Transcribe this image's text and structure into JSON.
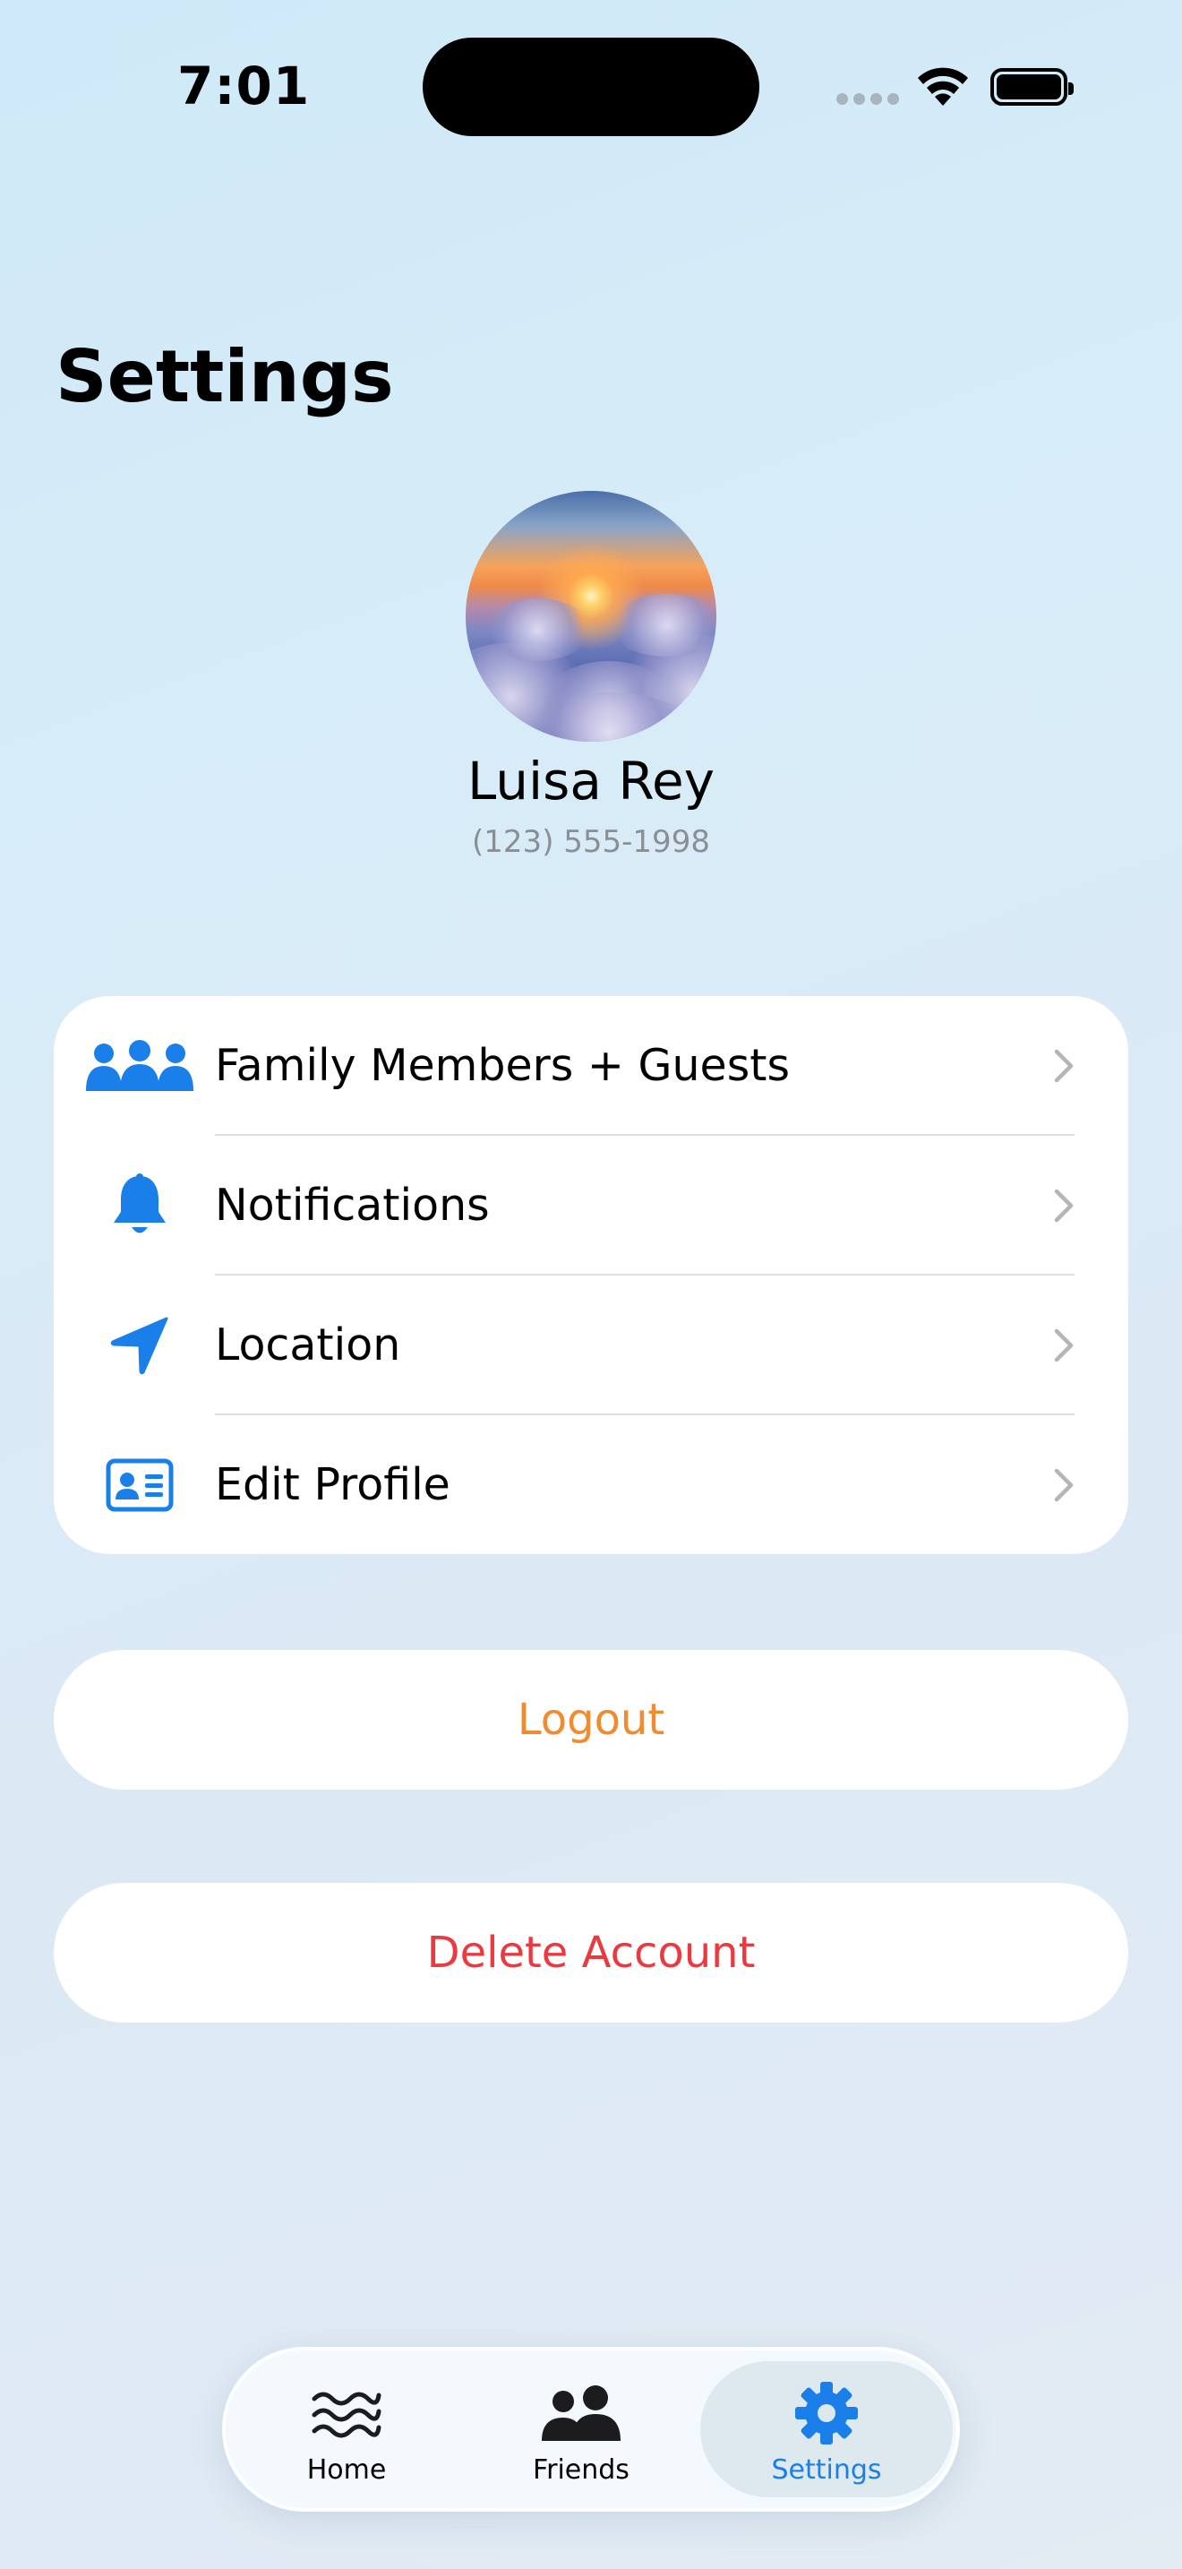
{
  "status_bar": {
    "time": "7:01"
  },
  "header": {
    "title": "Settings"
  },
  "profile": {
    "name": "Luisa Rey",
    "phone": "(123) 555-1998"
  },
  "menu": {
    "items": [
      {
        "label": "Family Members + Guests",
        "icon": "family-icon"
      },
      {
        "label": "Notifications",
        "icon": "bell-icon"
      },
      {
        "label": "Location",
        "icon": "location-arrow-icon"
      },
      {
        "label": "Edit Profile",
        "icon": "contact-card-icon"
      }
    ]
  },
  "actions": {
    "logout_label": "Logout",
    "delete_label": "Delete Account"
  },
  "tab_bar": {
    "tabs": [
      {
        "label": "Home",
        "icon": "waves-icon"
      },
      {
        "label": "Friends",
        "icon": "friends-icon"
      },
      {
        "label": "Settings",
        "icon": "gear-icon",
        "active": true
      }
    ]
  },
  "colors": {
    "accent_blue": "#1a7fe8",
    "logout_orange": "#f28a2e",
    "delete_red": "#ea3a3f"
  }
}
